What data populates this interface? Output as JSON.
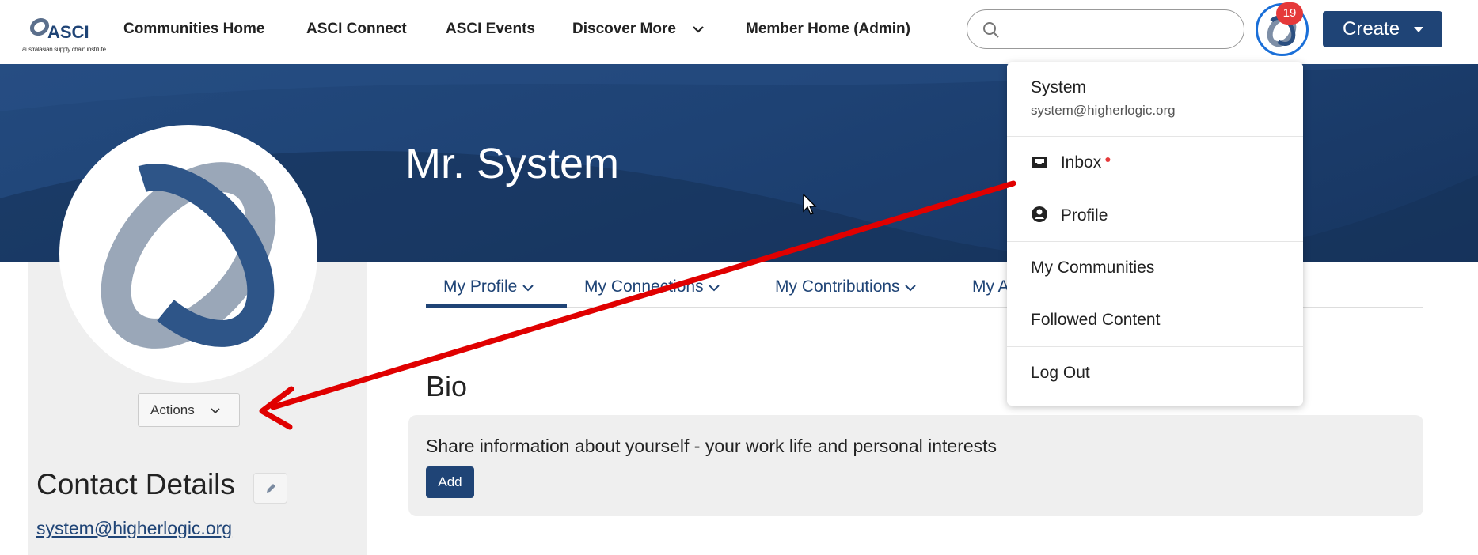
{
  "nav": {
    "logo_text": "ASCI",
    "logo_sub": "australasian supply chain institute",
    "items": [
      "Communities Home",
      "ASCI Connect",
      "ASCI Events",
      "Discover More",
      "Member Home (Admin)"
    ],
    "search_placeholder": "",
    "notification_count": "19",
    "create_label": "Create"
  },
  "profile": {
    "name": "Mr. System",
    "actions_label": "Actions",
    "contact_heading": "Contact Details",
    "email": "system@higherlogic.org"
  },
  "tabs": [
    "My Profile",
    "My Connections",
    "My Contributions",
    "My A"
  ],
  "bio": {
    "heading": "Bio",
    "prompt": "Share information about yourself - your work life and personal interests",
    "add_label": "Add"
  },
  "user_menu": {
    "name": "System",
    "email": "system@higherlogic.org",
    "items": [
      "Inbox",
      "Profile",
      "My Communities",
      "Followed Content",
      "Log Out"
    ]
  },
  "colors": {
    "brand": "#1f4476",
    "badge": "#e5393a",
    "annotation": "#e00000"
  }
}
